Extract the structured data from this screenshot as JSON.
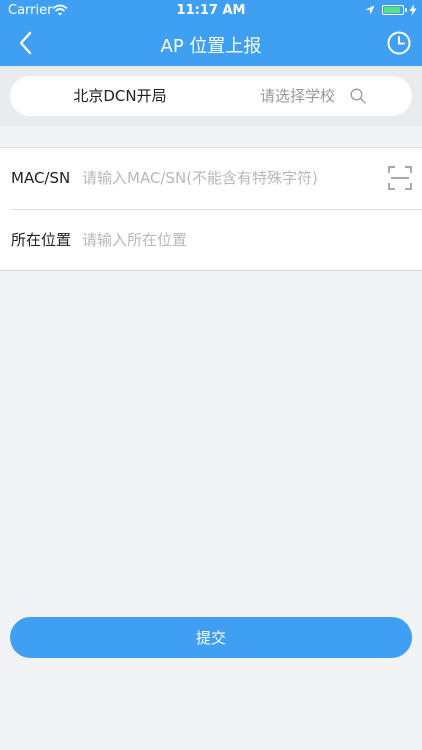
{
  "status_bar": {
    "carrier": "Carrier",
    "time": "11:17 AM",
    "battery_level": 0.9
  },
  "nav": {
    "title": "AP 位置上报",
    "back_icon": "chevron-left-icon",
    "history_icon": "clock-icon"
  },
  "filter": {
    "organization": "北京DCN开局",
    "school_placeholder": "请选择学校",
    "search_icon": "search-icon"
  },
  "form": {
    "mac_label": "MAC/SN",
    "mac_placeholder": "请输入MAC/SN(不能含有特殊字符)",
    "location_label": "所在位置",
    "location_placeholder": "请输入所在位置",
    "scan_icon": "scan-icon"
  },
  "actions": {
    "submit_label": "提交"
  },
  "colors": {
    "primary": "#3f9ff3",
    "background": "#f2f3f5",
    "placeholder": "#b8b8b8"
  }
}
